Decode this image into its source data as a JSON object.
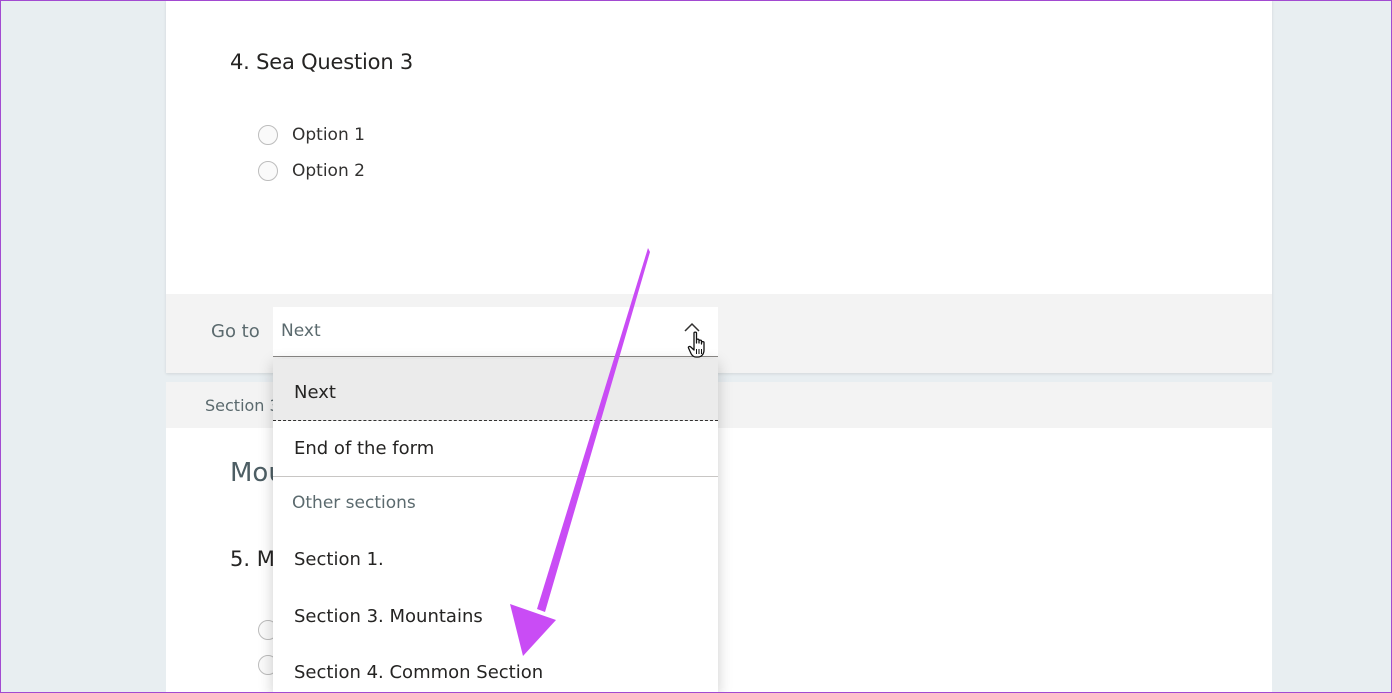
{
  "question4": {
    "title": "4. Sea Question 3",
    "options": [
      "Option 1",
      "Option 2"
    ]
  },
  "goto": {
    "label": "Go to",
    "selected": "Next"
  },
  "section3": {
    "header_partial": "Section 3",
    "title_partial": "Mou",
    "question5_partial": "5. M"
  },
  "dropdown": {
    "items": [
      "Next",
      "End of the form"
    ],
    "group_header": "Other sections",
    "sections": [
      "Section 1.",
      "Section 3. Mountains",
      "Section 4. Common Section"
    ]
  },
  "colors": {
    "annotation_arrow": "#c94cf5",
    "text_muted": "#5b6a6e",
    "page_background": "#e8eef1"
  },
  "icons": {
    "dropdown_toggle": "chevron-up-icon",
    "pointer": "hand-cursor-icon"
  }
}
